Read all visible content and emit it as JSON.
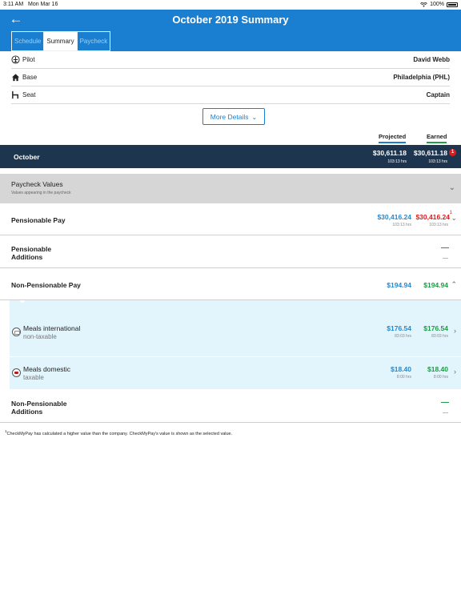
{
  "status": {
    "time": "3:11 AM",
    "date": "Mon Mar 16",
    "battery": "100%"
  },
  "header": {
    "title": "October 2019 Summary",
    "tabs": [
      {
        "label": "Schedule",
        "active": false
      },
      {
        "label": "Summary",
        "active": true
      },
      {
        "label": "Paycheck",
        "active": false
      }
    ]
  },
  "details": [
    {
      "icon": "pilot-icon",
      "label": "Pilot",
      "value": "David Webb"
    },
    {
      "icon": "home-icon",
      "label": "Base",
      "value": "Philadelphia (PHL)"
    },
    {
      "icon": "seat-icon",
      "label": "Seat",
      "value": "Captain"
    }
  ],
  "more_details_label": "More Details",
  "columns": {
    "projected": "Projected",
    "earned": "Earned"
  },
  "month": {
    "label": "October",
    "projected_amount": "$30,611.18",
    "projected_hrs": "103:13 hrs",
    "earned_amount": "$30,611.18",
    "earned_hrs": "103:13 hrs",
    "badge": "1"
  },
  "paycheck_values": {
    "title": "Paycheck Values",
    "subtitle": "Values appearing in the paycheck"
  },
  "rows": {
    "pensionable_pay": {
      "label": "Pensionable Pay",
      "projected": "$30,416.24",
      "projected_hrs": "103:13 hrs",
      "earned": "$30,416.24",
      "earned_hrs": "103:13 hrs",
      "footnote_mark": "1"
    },
    "pensionable_additions": {
      "label_line1": "Pensionable",
      "label_line2": "Additions",
      "earned": "—"
    },
    "non_pensionable_pay": {
      "label": "Non-Pensionable Pay",
      "projected": "$194.94",
      "earned": "$194.94"
    },
    "meals_international": {
      "name": "Meals international",
      "tax": "non-taxable",
      "projected": "$176.54",
      "projected_hrs": "83:03 hrs",
      "earned": "$176.54",
      "earned_hrs": "83:03 hrs"
    },
    "meals_domestic": {
      "name": "Meals domestic",
      "tax": "taxable",
      "projected": "$18.40",
      "projected_hrs": "8:00 hrs",
      "earned": "$18.40",
      "earned_hrs": "8:00 hrs"
    },
    "non_pensionable_additions": {
      "label_line1": "Non-Pensionable",
      "label_line2": "Additions",
      "earned": "—"
    }
  },
  "footnote": {
    "mark": "1",
    "text": "CheckMyPay has calculated a higher value than the company. CheckMyPay's value is shown as the selected value."
  }
}
